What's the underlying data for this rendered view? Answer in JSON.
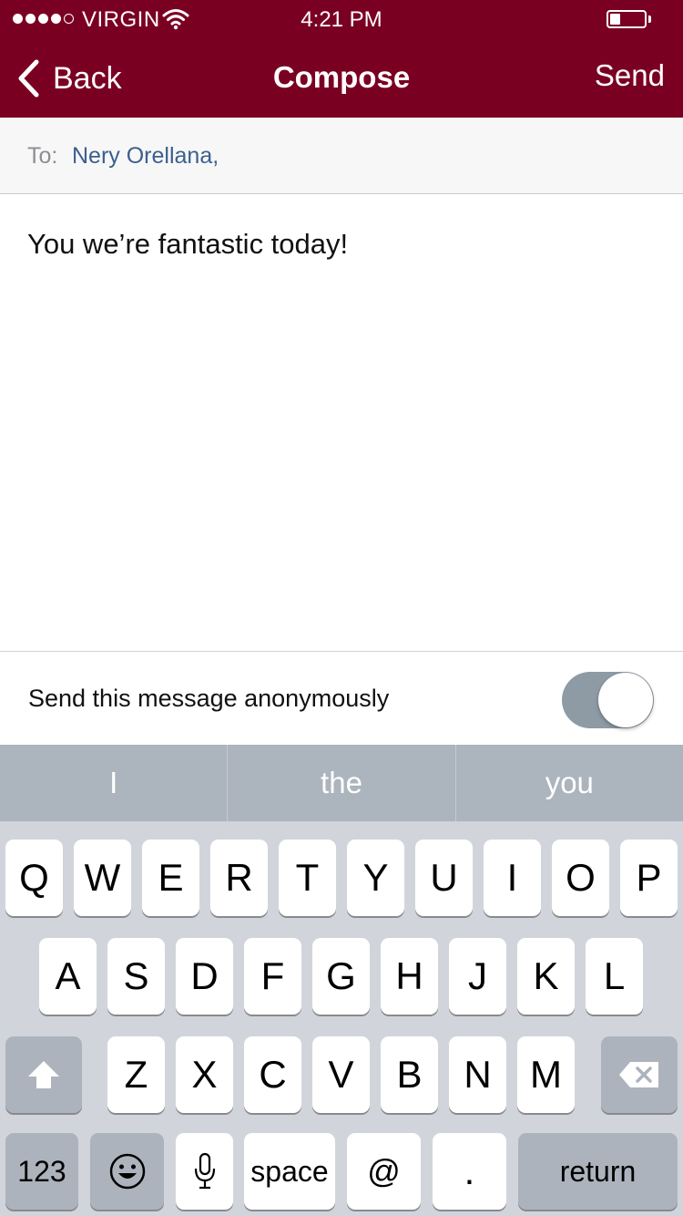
{
  "status_bar": {
    "carrier": "VIRGIN",
    "time": "4:21 PM",
    "signal_bars_filled": 4,
    "signal_bars_total": 5,
    "battery_level": 0.3
  },
  "nav": {
    "back_label": "Back",
    "title": "Compose",
    "send_label": "Send",
    "bar_color": "#7a0022"
  },
  "to_field": {
    "label": "To:",
    "value": "Nery Orellana,"
  },
  "message": {
    "body": "You we’re fantastic today!"
  },
  "anonymous": {
    "label": "Send this message anonymously",
    "enabled": true
  },
  "keyboard": {
    "suggestions": [
      "I",
      "the",
      "you"
    ],
    "row1": [
      "Q",
      "W",
      "E",
      "R",
      "T",
      "Y",
      "U",
      "I",
      "O",
      "P"
    ],
    "row2": [
      "A",
      "S",
      "D",
      "F",
      "G",
      "H",
      "J",
      "K",
      "L"
    ],
    "row3": [
      "Z",
      "X",
      "C",
      "V",
      "B",
      "N",
      "M"
    ],
    "numbers_label": "123",
    "space_label": "space",
    "at_label": "@",
    "dot_label": ".",
    "return_label": "return",
    "icons": {
      "shift": "shift-icon",
      "delete": "delete-icon",
      "emoji": "emoji-icon",
      "mic": "microphone-icon"
    }
  }
}
